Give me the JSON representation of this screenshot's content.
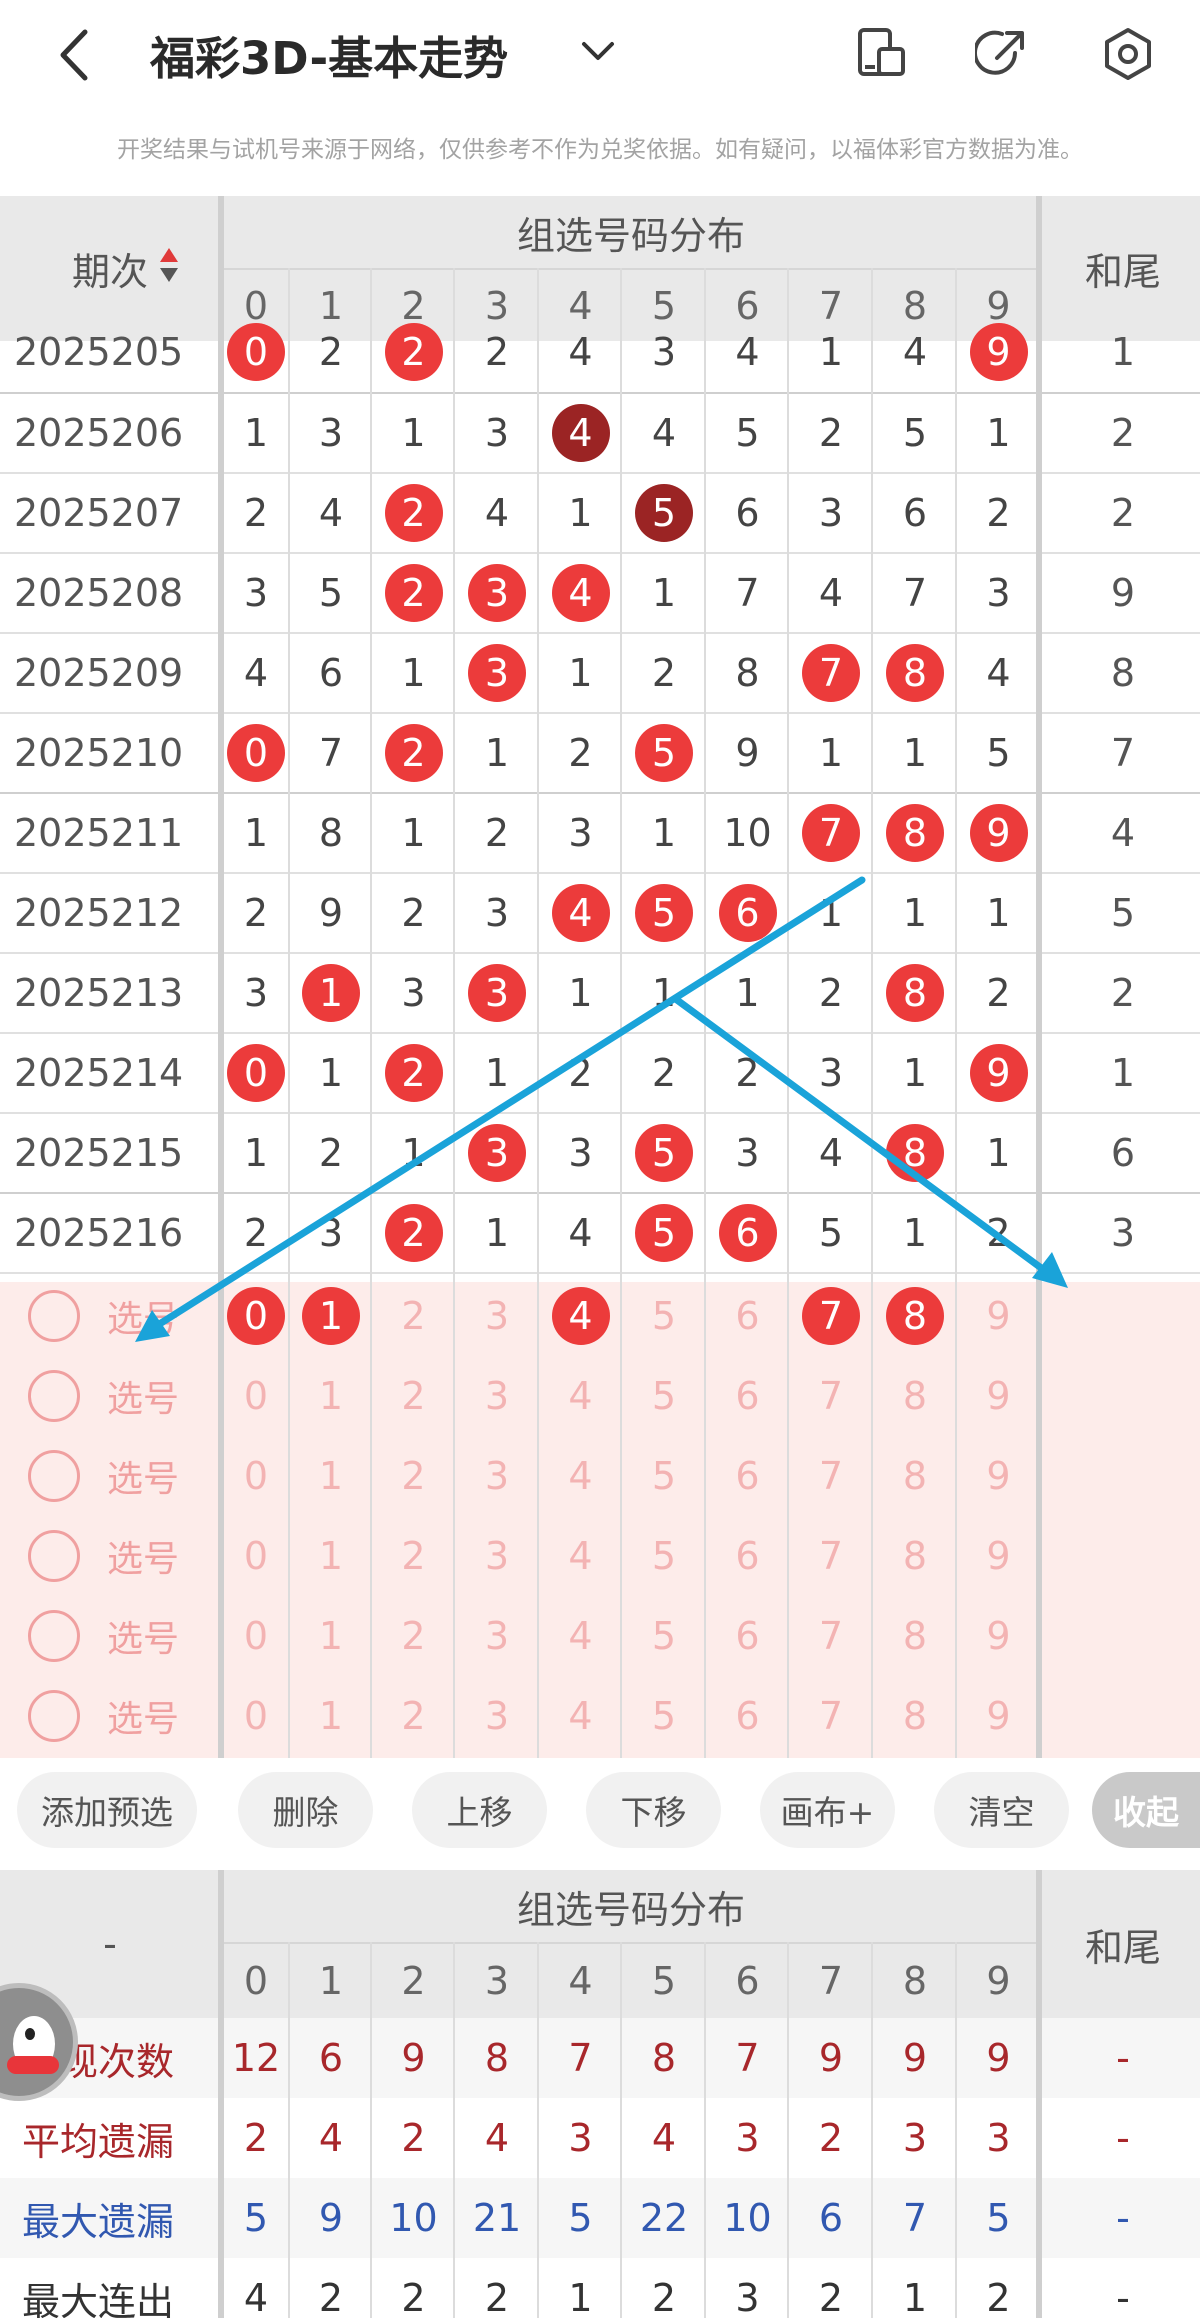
{
  "header": {
    "title": "福彩3D-基本走势",
    "notice": "开奖结果与试机号来源于网络，仅供参考不作为兑奖依据。如有疑问，以福体彩官方数据为准。"
  },
  "table": {
    "period_header": "期次",
    "group_header": "组选号码分布",
    "tail_header": "和尾",
    "digits": [
      "0",
      "1",
      "2",
      "3",
      "4",
      "5",
      "6",
      "7",
      "8",
      "9"
    ],
    "rows": [
      {
        "period": "2025205",
        "cells": [
          {
            "v": "0",
            "c": "r"
          },
          {
            "v": "2"
          },
          {
            "v": "2",
            "c": "r"
          },
          {
            "v": "2"
          },
          {
            "v": "4"
          },
          {
            "v": "3"
          },
          {
            "v": "4"
          },
          {
            "v": "1"
          },
          {
            "v": "4"
          },
          {
            "v": "9",
            "c": "r"
          }
        ],
        "tail": "1"
      },
      {
        "period": "2025206",
        "cells": [
          {
            "v": "1"
          },
          {
            "v": "3"
          },
          {
            "v": "1"
          },
          {
            "v": "3"
          },
          {
            "v": "4",
            "c": "d"
          },
          {
            "v": "4"
          },
          {
            "v": "5"
          },
          {
            "v": "2"
          },
          {
            "v": "5"
          },
          {
            "v": "1"
          }
        ],
        "tail": "2"
      },
      {
        "period": "2025207",
        "cells": [
          {
            "v": "2"
          },
          {
            "v": "4"
          },
          {
            "v": "2",
            "c": "r"
          },
          {
            "v": "4"
          },
          {
            "v": "1"
          },
          {
            "v": "5",
            "c": "d"
          },
          {
            "v": "6"
          },
          {
            "v": "3"
          },
          {
            "v": "6"
          },
          {
            "v": "2"
          }
        ],
        "tail": "2"
      },
      {
        "period": "2025208",
        "cells": [
          {
            "v": "3"
          },
          {
            "v": "5"
          },
          {
            "v": "2",
            "c": "r"
          },
          {
            "v": "3",
            "c": "r"
          },
          {
            "v": "4",
            "c": "r"
          },
          {
            "v": "1"
          },
          {
            "v": "7"
          },
          {
            "v": "4"
          },
          {
            "v": "7"
          },
          {
            "v": "3"
          }
        ],
        "tail": "9"
      },
      {
        "period": "2025209",
        "cells": [
          {
            "v": "4"
          },
          {
            "v": "6"
          },
          {
            "v": "1"
          },
          {
            "v": "3",
            "c": "r"
          },
          {
            "v": "1"
          },
          {
            "v": "2"
          },
          {
            "v": "8"
          },
          {
            "v": "7",
            "c": "r"
          },
          {
            "v": "8",
            "c": "r"
          },
          {
            "v": "4"
          }
        ],
        "tail": "8"
      },
      {
        "period": "2025210",
        "cells": [
          {
            "v": "0",
            "c": "r"
          },
          {
            "v": "7"
          },
          {
            "v": "2",
            "c": "r"
          },
          {
            "v": "1"
          },
          {
            "v": "2"
          },
          {
            "v": "5",
            "c": "r"
          },
          {
            "v": "9"
          },
          {
            "v": "1"
          },
          {
            "v": "1"
          },
          {
            "v": "5"
          }
        ],
        "tail": "7"
      },
      {
        "period": "2025211",
        "cells": [
          {
            "v": "1"
          },
          {
            "v": "8"
          },
          {
            "v": "1"
          },
          {
            "v": "2"
          },
          {
            "v": "3"
          },
          {
            "v": "1"
          },
          {
            "v": "10"
          },
          {
            "v": "7",
            "c": "r"
          },
          {
            "v": "8",
            "c": "r"
          },
          {
            "v": "9",
            "c": "r"
          }
        ],
        "tail": "4"
      },
      {
        "period": "2025212",
        "cells": [
          {
            "v": "2"
          },
          {
            "v": "9"
          },
          {
            "v": "2"
          },
          {
            "v": "3"
          },
          {
            "v": "4",
            "c": "r"
          },
          {
            "v": "5",
            "c": "r"
          },
          {
            "v": "6",
            "c": "r"
          },
          {
            "v": "1"
          },
          {
            "v": "1"
          },
          {
            "v": "1"
          }
        ],
        "tail": "5"
      },
      {
        "period": "2025213",
        "cells": [
          {
            "v": "3"
          },
          {
            "v": "1",
            "c": "r"
          },
          {
            "v": "3"
          },
          {
            "v": "3",
            "c": "r"
          },
          {
            "v": "1"
          },
          {
            "v": "1"
          },
          {
            "v": "1"
          },
          {
            "v": "2"
          },
          {
            "v": "8",
            "c": "r"
          },
          {
            "v": "2"
          }
        ],
        "tail": "2"
      },
      {
        "period": "2025214",
        "cells": [
          {
            "v": "0",
            "c": "r"
          },
          {
            "v": "1"
          },
          {
            "v": "2",
            "c": "r"
          },
          {
            "v": "1"
          },
          {
            "v": "2"
          },
          {
            "v": "2"
          },
          {
            "v": "2"
          },
          {
            "v": "3"
          },
          {
            "v": "1"
          },
          {
            "v": "9",
            "c": "r"
          }
        ],
        "tail": "1"
      },
      {
        "period": "2025215",
        "cells": [
          {
            "v": "1"
          },
          {
            "v": "2"
          },
          {
            "v": "1"
          },
          {
            "v": "3",
            "c": "r"
          },
          {
            "v": "3"
          },
          {
            "v": "5",
            "c": "r"
          },
          {
            "v": "3"
          },
          {
            "v": "4"
          },
          {
            "v": "8",
            "c": "r"
          },
          {
            "v": "1"
          }
        ],
        "tail": "6"
      },
      {
        "period": "2025216",
        "cells": [
          {
            "v": "2"
          },
          {
            "v": "3"
          },
          {
            "v": "2",
            "c": "r"
          },
          {
            "v": "1"
          },
          {
            "v": "4"
          },
          {
            "v": "5",
            "c": "r"
          },
          {
            "v": "6",
            "c": "r"
          },
          {
            "v": "5"
          },
          {
            "v": "1"
          },
          {
            "v": "2"
          }
        ],
        "tail": "3"
      }
    ],
    "selection_label": "选号",
    "selected_first_row": [
      true,
      true,
      false,
      false,
      true,
      false,
      false,
      true,
      true,
      false
    ]
  },
  "actions": {
    "add": "添加预选",
    "delete": "删除",
    "up": "上移",
    "down": "下移",
    "canvas": "画布+",
    "clear": "清空",
    "collapse": "收起"
  },
  "stats": {
    "corner": "-",
    "rows": [
      {
        "label": "出现次数",
        "values": [
          "12",
          "6",
          "9",
          "8",
          "7",
          "8",
          "7",
          "9",
          "9",
          "9"
        ],
        "tail": "-",
        "color": "#a8272b"
      },
      {
        "label": "平均遗漏",
        "values": [
          "2",
          "4",
          "2",
          "4",
          "3",
          "4",
          "3",
          "2",
          "3",
          "3"
        ],
        "tail": "-",
        "color": "#a8272b"
      },
      {
        "label": "最大遗漏",
        "values": [
          "5",
          "9",
          "10",
          "21",
          "5",
          "22",
          "10",
          "6",
          "7",
          "5"
        ],
        "tail": "-",
        "color": "#3158b0"
      },
      {
        "label": "最大连出",
        "values": [
          "4",
          "2",
          "2",
          "2",
          "1",
          "2",
          "3",
          "2",
          "1",
          "2"
        ],
        "tail": "-",
        "color": "#333333"
      }
    ]
  },
  "colors": {
    "hit": "#ec3b3b",
    "hit_dark": "#9b2424",
    "arrow": "#1aa3d9",
    "pink_bg": "#fdecea"
  }
}
